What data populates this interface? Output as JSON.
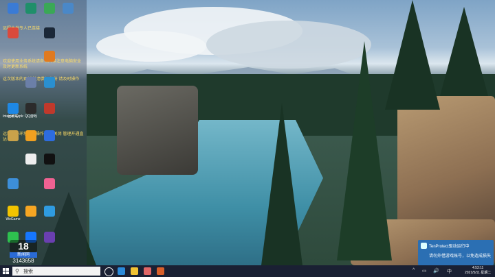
{
  "desktop": {
    "notes": [
      "远程本地专人已连接",
      "欢迎使用业务系统请各位同事注意电脑安全及时更新系统",
      "这次版本的更新 注意数据备份 请及时操作",
      "远程第一环境业务操作 请勿关闭 管理开通直达"
    ],
    "icons": [
      {
        "label": "",
        "icon": "app-blue-icon",
        "color": "#3a7bd5"
      },
      {
        "label": "",
        "icon": "app-x-icon",
        "color": "#1f8f6a"
      },
      {
        "label": "",
        "icon": "app-green-icon",
        "color": "#3aa856"
      },
      {
        "label": "",
        "icon": "app-cloud-icon",
        "color": "#4a88c8"
      },
      {
        "label": "",
        "icon": "app-chrome-icon",
        "color": "#d94a3d"
      },
      {
        "label": "",
        "icon": "app-steam-icon",
        "color": "#1b2838"
      },
      {
        "label": "",
        "icon": "app-orange-icon",
        "color": "#e07a1f"
      },
      {
        "label": "",
        "icon": "app-circle-icon",
        "color": "#2f6fd1"
      },
      {
        "label": "",
        "icon": "app-grid-icon",
        "color": "#6b7fa8"
      },
      {
        "label": "",
        "icon": "app-ring-icon",
        "color": "#2a8fd0"
      },
      {
        "label": "回收站",
        "icon": "recycle-bin-icon",
        "color": "#d6d6d6"
      },
      {
        "label": "",
        "icon": "app-gear-icon",
        "color": "#4caf50"
      },
      {
        "label": "",
        "icon": "app-purple-icon",
        "color": "#8e44ad"
      },
      {
        "label": "Internet Explorer",
        "icon": "internet-explorer-icon",
        "color": "#1e88e5"
      },
      {
        "label": "QQ游戏",
        "icon": "qq-game-icon",
        "color": "#2b2b2b"
      },
      {
        "label": "",
        "icon": "app-red-icon",
        "color": "#c0392b"
      },
      {
        "label": "",
        "icon": "app-folder-icon",
        "color": "#c9a24a"
      },
      {
        "label": "",
        "icon": "app-shield-icon",
        "color": "#f0a020"
      },
      {
        "label": "",
        "icon": "app-browser-icon",
        "color": "#2d6cdf"
      },
      {
        "label": "",
        "icon": "app-doc-icon",
        "color": "#eeeeee"
      },
      {
        "label": "",
        "icon": "app-mw-icon",
        "color": "#111111"
      },
      {
        "label": "",
        "icon": "app-person-icon",
        "color": "#3d8fd9"
      },
      {
        "label": "",
        "icon": "app-rainbow-icon",
        "color": "#f06292"
      },
      {
        "label": "WeGame",
        "icon": "wegame-icon",
        "color": "#f2c400"
      },
      {
        "label": "",
        "icon": "app-smile-icon",
        "color": "#f6a623"
      },
      {
        "label": "",
        "icon": "app-lens-icon",
        "color": "#2f9be0"
      },
      {
        "label": "",
        "icon": "app-wechat-icon",
        "color": "#2ec04f"
      },
      {
        "label": "",
        "icon": "app-penguin-icon",
        "color": "#1677ff"
      },
      {
        "label": "",
        "icon": "app-crown-icon",
        "color": "#6a3fb0"
      }
    ]
  },
  "widget": {
    "number": "18",
    "sub": "新闻网",
    "count": "3143658"
  },
  "notification": {
    "title": "TenProtect驱动运行中",
    "body": "请勿外借游戏账号，以免造成损失"
  },
  "taskbar": {
    "search_placeholder": "搜索",
    "pinned": [
      {
        "icon": "task-view-icon",
        "color": "#ffffff"
      },
      {
        "icon": "edge-icon",
        "color": "#2b8ad8"
      },
      {
        "icon": "file-explorer-icon",
        "color": "#f1c232"
      },
      {
        "icon": "store-icon",
        "color": "#e06666"
      },
      {
        "icon": "app-taskbar-icon",
        "color": "#d85f2a"
      }
    ],
    "tray": [
      "^",
      "▭",
      "🔊",
      "中"
    ],
    "time": "4:53:11",
    "date": "2021/5/11 星期二"
  },
  "colors": {
    "taskbar": "#1a2033",
    "notify": "#2b6fb3",
    "notes": "#ffdd66"
  }
}
